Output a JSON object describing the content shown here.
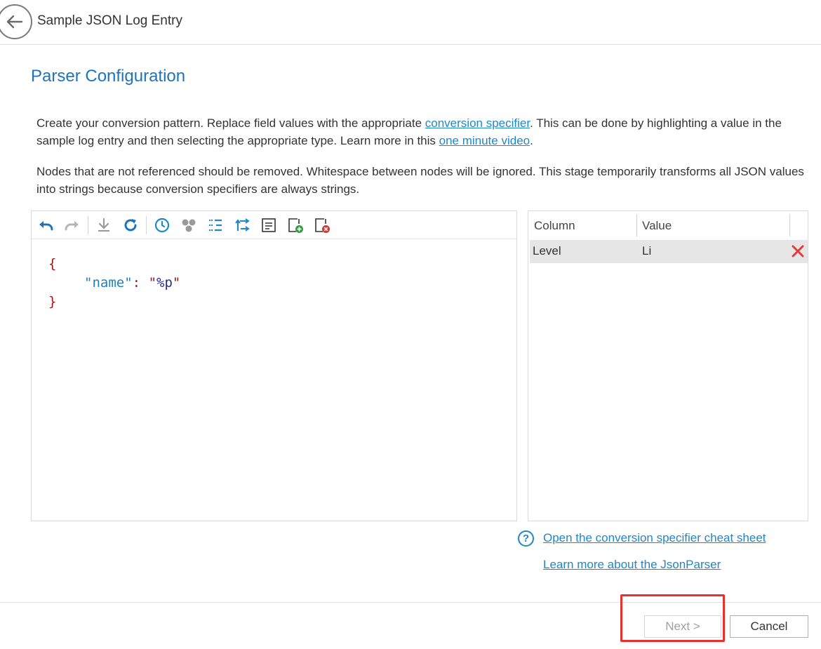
{
  "header": {
    "title": "Sample JSON Log Entry",
    "back_icon": "arrow-left-icon"
  },
  "section_title": "Parser Configuration",
  "description1": {
    "part1": "Create your conversion pattern.  Replace field values with the appropriate ",
    "link1": "conversion specifier",
    "part2": ".  This can be done by highlighting a value in the sample log entry and then selecting the appropriate type.  Learn more in this ",
    "link2": "one minute video",
    "part3": "."
  },
  "description2": "Nodes that are not referenced should be removed.  Whitespace between nodes will be ignored.  This stage temporarily transforms all JSON values into strings because conversion specifiers are always strings.",
  "toolbar": {
    "icons": [
      "undo-icon",
      "redo-icon",
      "download-icon",
      "refresh-icon",
      "clock-icon",
      "nodes-icon",
      "list-icon",
      "swap-icon",
      "text-icon",
      "add-node-icon",
      "remove-node-icon"
    ]
  },
  "editor": {
    "open_brace": "{",
    "key": "name",
    "colon": ":",
    "value": "%p",
    "close_brace": "}"
  },
  "table": {
    "col_header": "Column",
    "val_header": "Value",
    "rows": [
      {
        "column": "Level",
        "value": "Li"
      }
    ]
  },
  "links": {
    "help_glyph": "?",
    "cheat_sheet": "Open the conversion specifier cheat sheet",
    "json_parser": "Learn more about the JsonParser"
  },
  "buttons": {
    "next": "Next >",
    "cancel": "Cancel"
  },
  "colors": {
    "accent": "#1e74bb",
    "link": "#1e88c7",
    "highlight": "#e8312f",
    "delete": "#e03c3c"
  }
}
